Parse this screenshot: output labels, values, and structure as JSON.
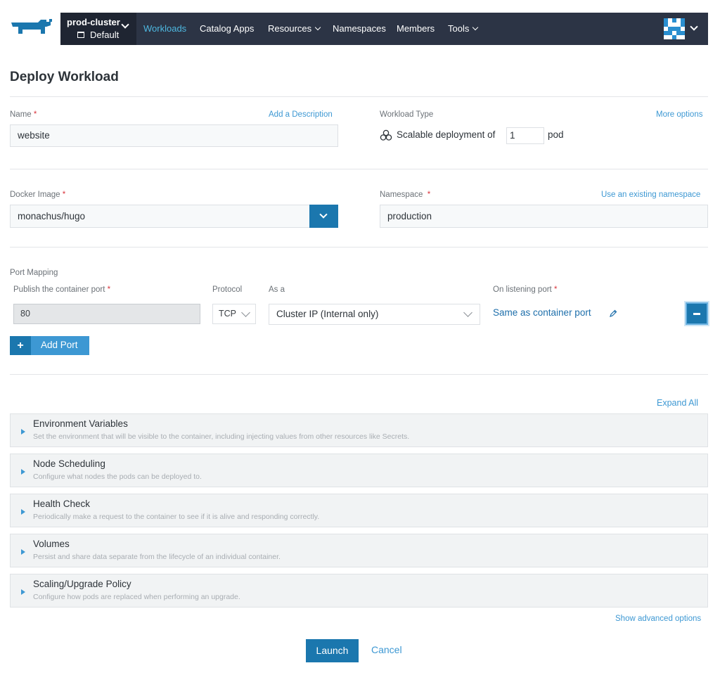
{
  "nav": {
    "cluster_name": "prod-cluster",
    "project_name": "Default",
    "items": [
      {
        "label": "Workloads",
        "active": true
      },
      {
        "label": "Catalog Apps"
      },
      {
        "label": "Resources",
        "dropdown": true
      },
      {
        "label": "Namespaces"
      },
      {
        "label": "Members"
      },
      {
        "label": "Tools",
        "dropdown": true
      }
    ],
    "accent_color": "#4eb8e0",
    "background_color": "#2c3445"
  },
  "page": {
    "title": "Deploy Workload"
  },
  "form": {
    "name": {
      "label": "Name",
      "required_mark": "*",
      "value": "website",
      "add_description_link": "Add a Description"
    },
    "workload_type": {
      "label": "Workload Type",
      "more_options_link": "More options",
      "prefix": "Scalable deployment of",
      "pod_count": "1",
      "suffix": "pod"
    },
    "docker_image": {
      "label": "Docker Image",
      "required_mark": "*",
      "value": "monachus/hugo"
    },
    "namespace": {
      "label": "Namespace",
      "required_mark": "*",
      "value": "production",
      "use_existing_link": "Use an existing namespace"
    },
    "port_mapping": {
      "label": "Port Mapping",
      "col_publish": "Publish the container port",
      "col_protocol": "Protocol",
      "col_as": "As a",
      "col_listening": "On listening port",
      "required_mark": "*",
      "row": {
        "port": "80",
        "protocol": "TCP",
        "as_a": "Cluster IP (Internal only)",
        "listening_port": "Same as container port"
      },
      "add_port_label": "Add Port",
      "add_port_plus": "+"
    }
  },
  "sections": {
    "expand_all": "Expand All",
    "items": [
      {
        "title": "Environment Variables",
        "description": "Set the environment that will be visible to the container, including injecting values from other resources like Secrets."
      },
      {
        "title": "Node Scheduling",
        "description": "Configure what nodes the pods can be deployed to."
      },
      {
        "title": "Health Check",
        "description": "Periodically make a request to the container to see if it is alive and responding correctly."
      },
      {
        "title": "Volumes",
        "description": "Persist and share data separate from the lifecycle of an individual container."
      },
      {
        "title": "Scaling/Upgrade Policy",
        "description": "Configure how pods are replaced when performing an upgrade."
      }
    ],
    "show_advanced": "Show advanced options"
  },
  "actions": {
    "launch": "Launch",
    "cancel": "Cancel"
  },
  "colors": {
    "primary": "#1b77ae",
    "link": "#3d98d3",
    "required": "#d9373f"
  }
}
